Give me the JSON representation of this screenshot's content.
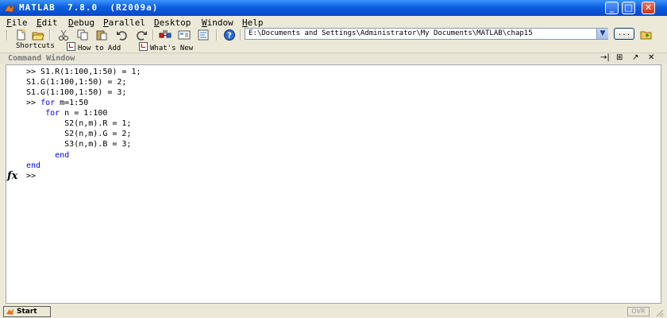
{
  "window": {
    "title": "MATLAB  7.8.0  (R2009a)",
    "controls": {
      "minimize": "_",
      "maximize": "□",
      "close": "✕"
    }
  },
  "menu": [
    "File",
    "Edit",
    "Debug",
    "Parallel",
    "Desktop",
    "Window",
    "Help"
  ],
  "toolbar": {
    "icons": [
      "new-file-icon",
      "open-folder-icon",
      "cut-icon",
      "copy-icon",
      "paste-icon",
      "undo-icon",
      "redo-icon",
      "simulink-icon",
      "guide-icon",
      "profiler-icon",
      "help-icon"
    ],
    "current_directory": "E:\\Documents and Settings\\Administrator\\My Documents\\MATLAB\\chap15",
    "browse_label": "...",
    "dropdown_arrow": "▼"
  },
  "shortcuts": {
    "label": "Shortcuts",
    "items": [
      "How to Add",
      "What's New"
    ]
  },
  "command_window": {
    "title": "Command Window",
    "controls": [
      "→|",
      "⊞",
      "↗",
      "✕"
    ],
    "lines": [
      ">> S1.R(1:100,1:50) = 1;",
      "S1.G(1:100,1:50) = 2;",
      "S1.G(1:100,1:50) = 3;",
      ">> for m=1:50",
      "    for n = 1:100",
      "        S2(n,m).R = 1;",
      "        S2(n,m).G = 2;",
      "        S3(n,m).B = 3;",
      "      end",
      "end",
      ">>"
    ],
    "fx_label": "fx"
  },
  "statusbar": {
    "start_label": "Start",
    "ovr_label": "OVR"
  },
  "colors": {
    "keyword": "#0000ff",
    "titlebar": "#0a5fe0"
  }
}
